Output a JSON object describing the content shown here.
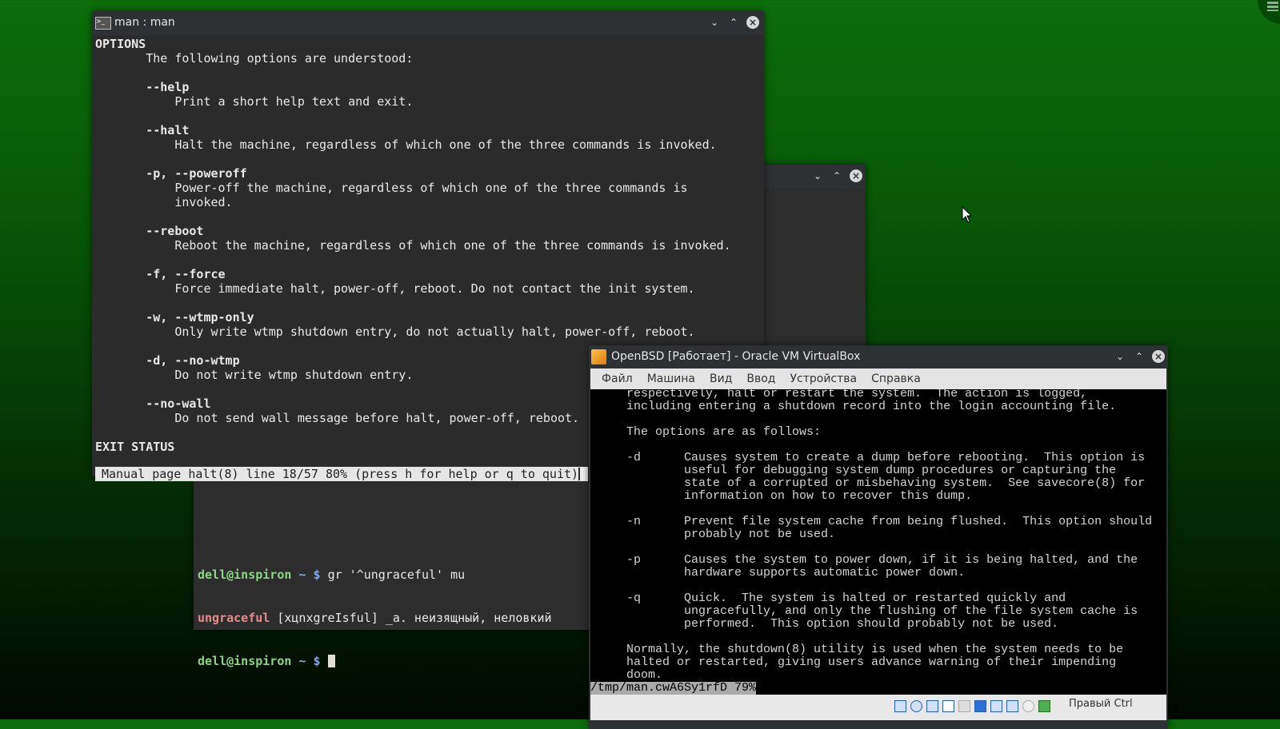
{
  "man_window": {
    "title": "man : man",
    "lines": [
      {
        "t": "OPTIONS",
        "b": true
      },
      {
        "t": "       The following options are understood:"
      },
      {
        "t": ""
      },
      {
        "t": "       --help",
        "b": true
      },
      {
        "t": "           Print a short help text and exit."
      },
      {
        "t": ""
      },
      {
        "t": "       --halt",
        "b": true
      },
      {
        "t": "           Halt the machine, regardless of which one of the three commands is invoked."
      },
      {
        "t": ""
      },
      {
        "t": "       -p, --poweroff",
        "b": true
      },
      {
        "t": "           Power-off the machine, regardless of which one of the three commands is"
      },
      {
        "t": "           invoked."
      },
      {
        "t": ""
      },
      {
        "t": "       --reboot",
        "b": true
      },
      {
        "t": "           Reboot the machine, regardless of which one of the three commands is invoked."
      },
      {
        "t": ""
      },
      {
        "t": "       -f, --force",
        "b": true
      },
      {
        "t": "           Force immediate halt, power-off, reboot. Do not contact the init system."
      },
      {
        "t": ""
      },
      {
        "t": "       -w, --wtmp-only",
        "b": true
      },
      {
        "t": "           Only write wtmp shutdown entry, do not actually halt, power-off, reboot."
      },
      {
        "t": ""
      },
      {
        "t": "       -d, --no-wtmp",
        "b": true
      },
      {
        "t": "           Do not write wtmp shutdown entry."
      },
      {
        "t": ""
      },
      {
        "t": "       --no-wall",
        "b": true
      },
      {
        "t": "           Do not send wall message before halt, power-off, reboot."
      },
      {
        "t": ""
      },
      {
        "t": "EXIT STATUS",
        "b": true
      }
    ],
    "status": "Manual page halt(8) line 18/57 80% (press h for help or q to quit)"
  },
  "terminal_window": {
    "prompt_user": "dell@inspiron",
    "prompt_tail": " ~ $ ",
    "command": "gr '^ungraceful' mu",
    "result_word": "ungraceful",
    "result_rest": " [xцnxgreIsful] _a. неизящный, неловкий"
  },
  "vbox_window": {
    "title": "OpenBSD [Работает] - Oracle VM VirtualBox",
    "menu": [
      "Файл",
      "Машина",
      "Вид",
      "Ввод",
      "Устройства",
      "Справка"
    ],
    "console_lines": [
      "respectively, halt or restart the system.  The action is logged,",
      "including entering a shutdown record into the login accounting file.",
      "",
      "The options are as follows:",
      "",
      "-d      Causes system to create a dump before rebooting.  This option is",
      "        useful for debugging system dump procedures or capturing the",
      "        state of a corrupted or misbehaving system.  See savecore(8) for",
      "        information on how to recover this dump.",
      "",
      "-n      Prevent file system cache from being flushed.  This option should",
      "        probably not be used.",
      "",
      "-p      Causes the system to power down, if it is being halted, and the",
      "        hardware supports automatic power down.",
      "",
      "-q      Quick.  The system is halted or restarted quickly and",
      "        ungracefully, and only the flushing of the file system cache is",
      "        performed.  This option should probably not be used.",
      "",
      "Normally, the shutdown(8) utility is used when the system needs to be",
      "halted or restarted, giving users advance warning of their impending",
      "doom."
    ],
    "pager_status": "/tmp/man.cwA6Sy1rfD 79%",
    "host_key": "Правый Ctrl"
  }
}
